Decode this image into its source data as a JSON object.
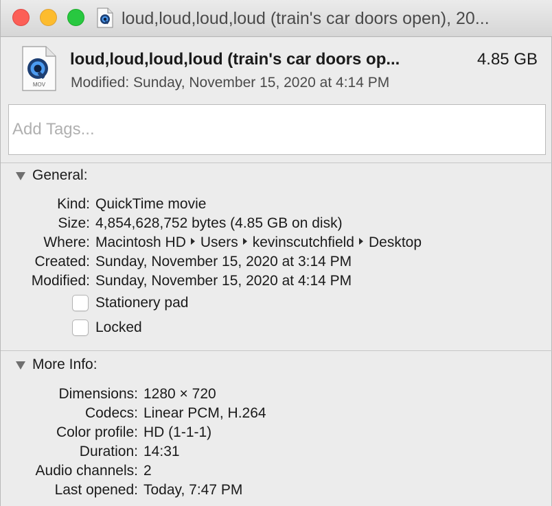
{
  "window": {
    "title": "loud,loud,loud,loud (train's car doors open), 20..."
  },
  "header": {
    "file_name": "loud,loud,loud,loud (train's car doors op...",
    "file_size": "4.85 GB",
    "modified": "Modified: Sunday, November 15, 2020 at 4:14 PM",
    "icon_ext": "MOV"
  },
  "tags": {
    "placeholder": "Add Tags..."
  },
  "general": {
    "title": "General:",
    "kind_label": "Kind:",
    "kind": "QuickTime movie",
    "size_label": "Size:",
    "size": "4,854,628,752 bytes (4.85 GB on disk)",
    "where_label": "Where:",
    "where_path": [
      "Macintosh HD",
      "Users",
      "kevinscutchfield",
      "Desktop"
    ],
    "created_label": "Created:",
    "created": "Sunday, November 15, 2020 at 3:14 PM",
    "modified_label": "Modified:",
    "modified": "Sunday, November 15, 2020 at 4:14 PM",
    "stationery_label": "Stationery pad",
    "stationery_checked": false,
    "locked_label": "Locked",
    "locked_checked": false
  },
  "more_info": {
    "title": "More Info:",
    "dimensions_label": "Dimensions:",
    "dimensions": "1280 × 720",
    "codecs_label": "Codecs:",
    "codecs": "Linear PCM, H.264",
    "color_profile_label": "Color profile:",
    "color_profile": "HD (1-1-1)",
    "duration_label": "Duration:",
    "duration": "14:31",
    "audio_channels_label": "Audio channels:",
    "audio_channels": "2",
    "last_opened_label": "Last opened:",
    "last_opened": "Today, 7:47 PM"
  },
  "colors": {
    "close": "#fc5f57",
    "minimize": "#fdbc2e",
    "maximize": "#28c840",
    "quicktime_blue": "#2a6fc9"
  },
  "icons": [
    "quicktime-file-icon",
    "disclosure-triangle-icon",
    "path-separator-icon"
  ]
}
